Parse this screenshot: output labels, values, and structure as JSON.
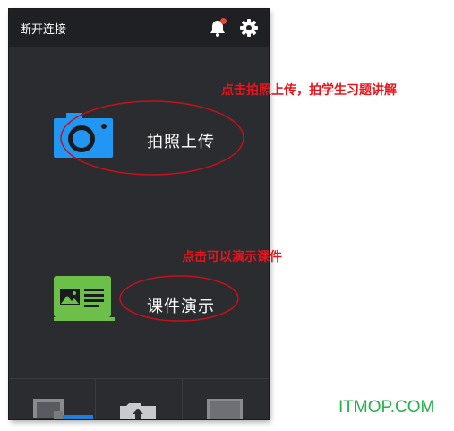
{
  "header": {
    "title": "断开连接",
    "notification_icon": "bell-icon",
    "settings_icon": "gear-icon",
    "badge_color": "#e8443a"
  },
  "main": {
    "photo_upload": {
      "label": "拍照上传",
      "icon": "camera-icon",
      "icon_color": "#2196f3"
    },
    "courseware": {
      "label": "课件演示",
      "icon": "slideshow-icon",
      "icon_color": "#6cc04a"
    }
  },
  "bottom_tabs": [
    {
      "icon": "devices-icon"
    },
    {
      "icon": "folder-upload-icon"
    },
    {
      "icon": "laptop-icon"
    }
  ],
  "annotations": {
    "photo": "点击拍照上传，拍学生习题讲解",
    "courseware": "点击可以演示课件",
    "color": "#e8141c"
  },
  "watermark": {
    "text": "ITMOP.COM",
    "color": "#22b14c"
  }
}
